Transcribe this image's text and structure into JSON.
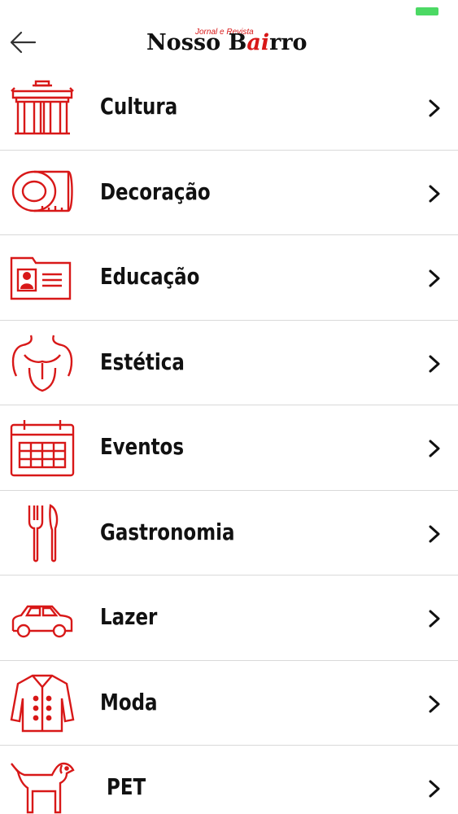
{
  "header": {
    "logo": {
      "sub": "Jornal e Revista",
      "main_pre": "Nosso B",
      "main_accent": "ai",
      "main_post": "rro"
    }
  },
  "menu": [
    {
      "label": "Cultura",
      "icon": "gate-monument-icon"
    },
    {
      "label": "Decoração",
      "icon": "measuring-tape-icon"
    },
    {
      "label": "Educação",
      "icon": "id-card-icon"
    },
    {
      "label": "Estética",
      "icon": "torso-icon"
    },
    {
      "label": "Eventos",
      "icon": "calendar-icon"
    },
    {
      "label": "Gastronomia",
      "icon": "fork-knife-icon"
    },
    {
      "label": "Lazer",
      "icon": "car-icon"
    },
    {
      "label": "Moda",
      "icon": "jacket-icon"
    },
    {
      "label": "PET",
      "icon": "dog-icon"
    }
  ],
  "colors": {
    "accent": "#d81818",
    "text": "#111111",
    "divider": "#d9d9d9",
    "battery": "#4cd964"
  }
}
